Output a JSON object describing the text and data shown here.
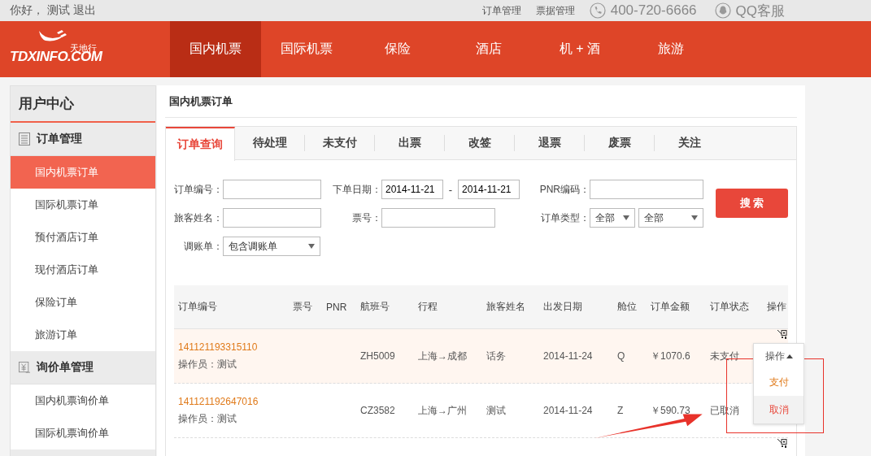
{
  "top_bar": {
    "greeting": "你好，",
    "user": "测试",
    "logout": "退出",
    "links": [
      "订单管理",
      "票据管理"
    ],
    "phone": "400-720-6666",
    "service": "QQ客服"
  },
  "nav": {
    "logo": {
      "brand": "TDXINFO.COM",
      "name": "天地行"
    },
    "items": [
      {
        "label": "国内机票",
        "selected": true
      },
      {
        "label": "国际机票",
        "selected": false
      },
      {
        "label": "保险",
        "selected": false
      },
      {
        "label": "酒店",
        "selected": false
      },
      {
        "label": "机 + 酒",
        "selected": false
      },
      {
        "label": "旅游",
        "selected": false
      }
    ]
  },
  "sidebar": {
    "title": "用户中心",
    "groups": [
      {
        "label": "订单管理",
        "kind": "list",
        "items": [
          {
            "label": "国内机票订单",
            "selected": true
          },
          {
            "label": "国际机票订单",
            "selected": false
          },
          {
            "label": "预付酒店订单",
            "selected": false
          },
          {
            "label": "现付酒店订单",
            "selected": false
          },
          {
            "label": "保险订单",
            "selected": false
          },
          {
            "label": "旅游订单",
            "selected": false
          }
        ]
      },
      {
        "label": "询价单管理",
        "kind": "price",
        "items": [
          {
            "label": "国内机票询价单",
            "selected": false
          },
          {
            "label": "国际机票询价单",
            "selected": false
          }
        ]
      }
    ]
  },
  "page_title": "国内机票订单",
  "tabs": [
    {
      "label": "订单查询",
      "selected": true
    },
    {
      "label": "待处理",
      "selected": false
    },
    {
      "label": "未支付",
      "selected": false
    },
    {
      "label": "出票",
      "selected": false
    },
    {
      "label": "改签",
      "selected": false
    },
    {
      "label": "退票",
      "selected": false
    },
    {
      "label": "废票",
      "selected": false
    },
    {
      "label": "关注",
      "selected": false
    }
  ],
  "form": {
    "fields": [
      {
        "label": "订单编号：",
        "kind": "text"
      },
      {
        "label": "下单日期：",
        "kind": "date-range",
        "values": [
          "2014-11-21",
          "2014-11-21"
        ],
        "separator": "-"
      },
      {
        "label": "PNR编码：",
        "kind": "text"
      },
      {
        "label": "旅客姓名：",
        "kind": "text"
      },
      {
        "label": "票号：",
        "kind": "text"
      },
      {
        "label": "订单类型：",
        "kind": "selects",
        "values": [
          "全部",
          "全部"
        ]
      },
      {
        "label": "调账单：",
        "kind": "selects",
        "values": [
          "包含调账单"
        ]
      }
    ],
    "search_button": "搜 索"
  },
  "table": {
    "columns": [
      "订单编号",
      "票号",
      "PNR",
      "航班号",
      "行程",
      "旅客姓名",
      "出发日期",
      "舱位",
      "订单金额",
      "订单状态",
      "操作"
    ],
    "rows": [
      {
        "order_no": "141121193315110",
        "operator": "操作员：测试",
        "ticket": "",
        "pnr": "",
        "flight": "ZH5009",
        "route": "上海→成都",
        "passenger": "话务",
        "date": "2014-11-24",
        "cabin": "Q",
        "amount": "￥1070.6",
        "status": "未支付",
        "selected": true
      },
      {
        "order_no": "141121192647016",
        "operator": "操作员：测试",
        "ticket": "",
        "pnr": "",
        "flight": "CZ3582",
        "route": "上海→广州",
        "passenger": "测试",
        "date": "2014-11-24",
        "cabin": "Z",
        "amount": "￥590.73",
        "status": "已取消",
        "selected": false
      }
    ]
  },
  "action_menu": {
    "title": "操作",
    "items": [
      {
        "label": "支付",
        "selected": false
      },
      {
        "label": "取消",
        "selected": true
      }
    ]
  }
}
